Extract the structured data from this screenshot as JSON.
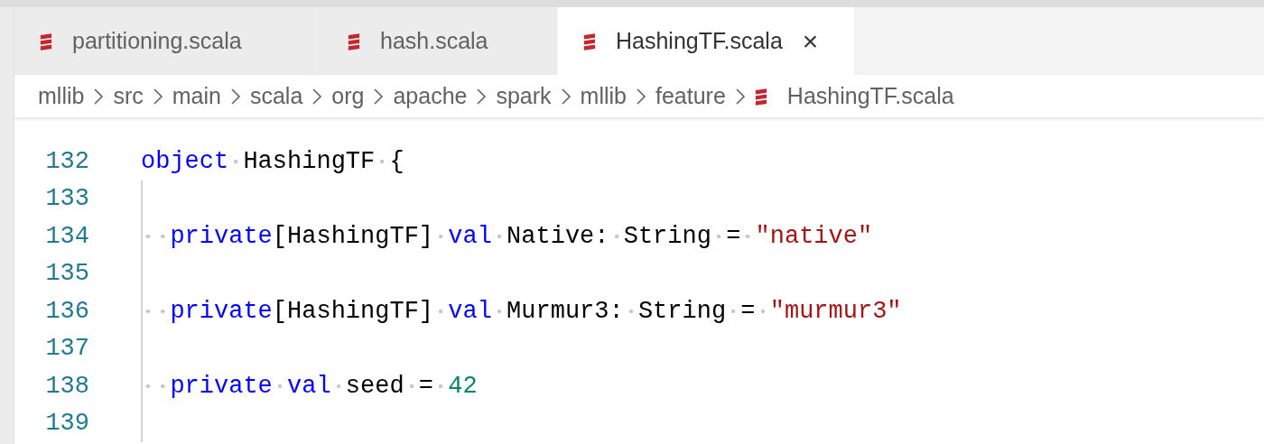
{
  "tabs": [
    {
      "label": "partitioning.scala",
      "selected": false
    },
    {
      "label": "hash.scala",
      "selected": false
    },
    {
      "label": "HashingTF.scala",
      "selected": true,
      "close": "×"
    }
  ],
  "breadcrumb": [
    {
      "label": "mllib",
      "kind": "folder"
    },
    {
      "label": "src",
      "kind": "folder"
    },
    {
      "label": "main",
      "kind": "folder"
    },
    {
      "label": "scala",
      "kind": "folder"
    },
    {
      "label": "org",
      "kind": "folder"
    },
    {
      "label": "apache",
      "kind": "folder"
    },
    {
      "label": "spark",
      "kind": "folder"
    },
    {
      "label": "mllib",
      "kind": "folder"
    },
    {
      "label": "feature",
      "kind": "folder"
    },
    {
      "label": "HashingTF.scala",
      "kind": "file"
    }
  ],
  "lines": [
    {
      "number": "132",
      "tokens": [
        {
          "kind": "keyword",
          "text": "object"
        },
        {
          "kind": "plain",
          "text": " HashingTF {"
        }
      ]
    },
    {
      "number": "133"
    },
    {
      "number": "134",
      "tokens": [
        {
          "kind": "keyword",
          "text": "  private"
        },
        {
          "kind": "plain",
          "text": "[HashingTF] "
        },
        {
          "kind": "keyword",
          "text": "val"
        },
        {
          "kind": "plain",
          "text": " Native: String = "
        },
        {
          "kind": "string",
          "text": "\"native\""
        }
      ]
    },
    {
      "number": "135"
    },
    {
      "number": "136",
      "tokens": [
        {
          "kind": "keyword",
          "text": "  private"
        },
        {
          "kind": "plain",
          "text": "[HashingTF] "
        },
        {
          "kind": "keyword",
          "text": "val"
        },
        {
          "kind": "plain",
          "text": " Murmur3: String = "
        },
        {
          "kind": "string",
          "text": "\"murmur3\""
        }
      ]
    },
    {
      "number": "137"
    },
    {
      "number": "138",
      "tokens": [
        {
          "kind": "keyword",
          "text": "  private val"
        },
        {
          "kind": "plain",
          "text": " seed = "
        },
        {
          "kind": "number",
          "text": "42"
        }
      ]
    },
    {
      "number": "139"
    }
  ]
}
